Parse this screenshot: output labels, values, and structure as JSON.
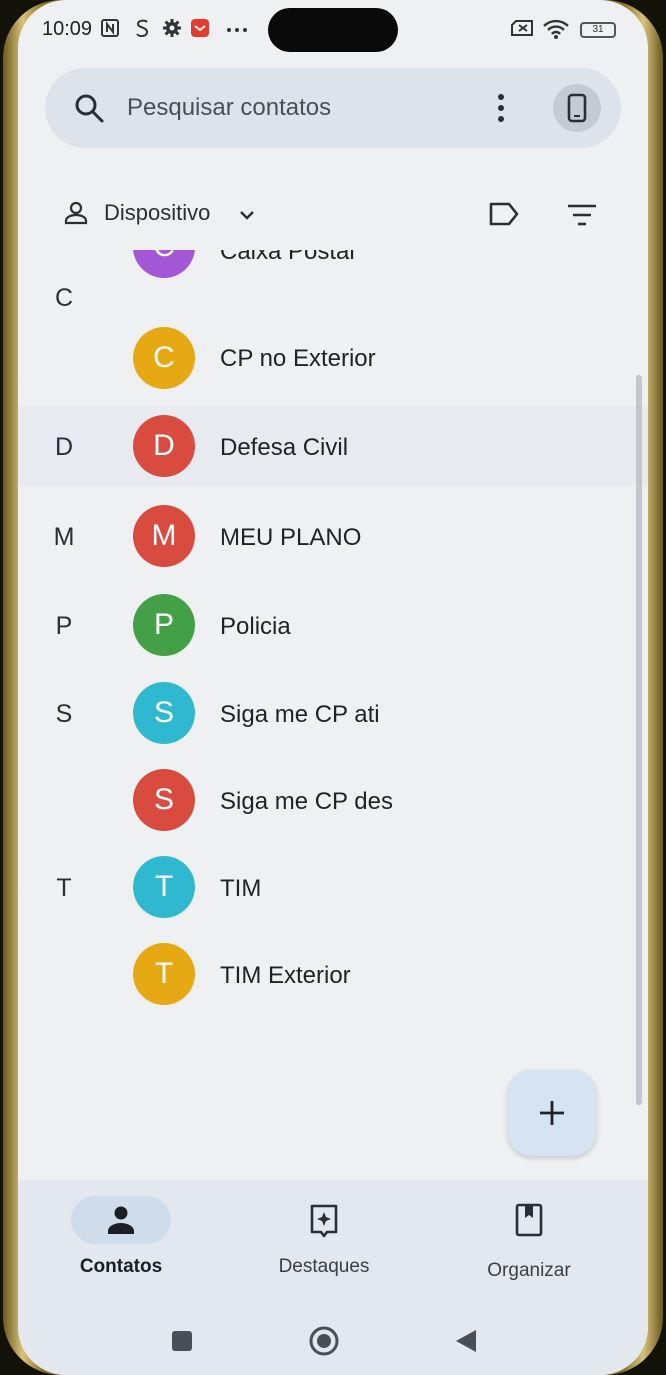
{
  "status_bar": {
    "time": "10:09",
    "battery": "31",
    "icons": [
      "nfc-icon",
      "s-icon",
      "settings-icon",
      "app-notification-icon",
      "more-dots-icon",
      "sim-off-icon",
      "wifi-icon",
      "battery-icon"
    ]
  },
  "search": {
    "placeholder": "Pesquisar contatos",
    "icon": "search-icon"
  },
  "filter": {
    "account_label": "Dispositivo"
  },
  "colors": {
    "purple": "#a357d6",
    "yellow": "#e6a913",
    "red": "#d94a3f",
    "green": "#43a047",
    "cyan": "#2fb9d0"
  },
  "contacts": [
    {
      "section": "",
      "initial": "C",
      "name": "Caixa Postal",
      "color": "#a357d6"
    },
    {
      "section": "C",
      "initial": "",
      "name": "",
      "color": ""
    },
    {
      "section": "",
      "initial": "C",
      "name": "CP no Exterior",
      "color": "#e6a913"
    },
    {
      "section": "D",
      "initial": "D",
      "name": "Defesa Civil",
      "color": "#d94a3f"
    },
    {
      "section": "M",
      "initial": "M",
      "name": "MEU PLANO",
      "color": "#d94a3f"
    },
    {
      "section": "P",
      "initial": "P",
      "name": "Policia",
      "color": "#43a047"
    },
    {
      "section": "S",
      "initial": "S",
      "name": "Siga me CP ati",
      "color": "#2fb9d0"
    },
    {
      "section": "",
      "initial": "S",
      "name": "Siga me CP des",
      "color": "#d94a3f"
    },
    {
      "section": "T",
      "initial": "T",
      "name": "TIM",
      "color": "#2fb9d0"
    },
    {
      "section": "",
      "initial": "T",
      "name": "TIM Exterior",
      "color": "#e6a913"
    }
  ],
  "fab": {
    "icon": "plus-icon"
  },
  "bottom_nav": {
    "items": [
      {
        "label": "Contatos",
        "icon": "person-icon",
        "active": true
      },
      {
        "label": "Destaques",
        "icon": "highlights-icon",
        "active": false
      },
      {
        "label": "Organizar",
        "icon": "bookmark-icon",
        "active": false
      }
    ]
  },
  "system_nav": [
    "recents-button",
    "home-button",
    "back-button"
  ]
}
